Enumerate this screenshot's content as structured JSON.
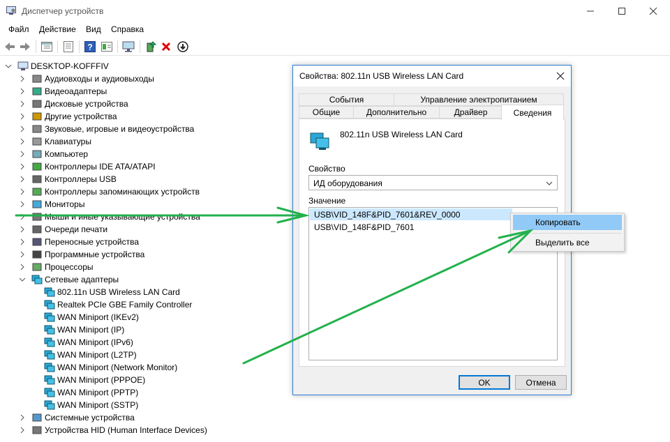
{
  "window": {
    "title": "Диспетчер устройств"
  },
  "menu": [
    "Файл",
    "Действие",
    "Вид",
    "Справка"
  ],
  "tree": {
    "root": "DESKTOP-KOFFFIV",
    "categories": [
      {
        "label": "Аудиовходы и аудиовыходы",
        "icon": "speaker-icon"
      },
      {
        "label": "Видеоадаптеры",
        "icon": "display-adapter-icon"
      },
      {
        "label": "Дисковые устройства",
        "icon": "disk-icon"
      },
      {
        "label": "Другие устройства",
        "icon": "unknown-device-icon"
      },
      {
        "label": "Звуковые, игровые и видеоустройства",
        "icon": "speaker-icon"
      },
      {
        "label": "Клавиатуры",
        "icon": "keyboard-icon"
      },
      {
        "label": "Компьютер",
        "icon": "computer-icon"
      },
      {
        "label": "Контроллеры IDE ATA/ATAPI",
        "icon": "ide-icon"
      },
      {
        "label": "Контроллеры USB",
        "icon": "usb-icon"
      },
      {
        "label": "Контроллеры запоминающих устройств",
        "icon": "storage-icon"
      },
      {
        "label": "Мониторы",
        "icon": "monitor-icon"
      },
      {
        "label": "Мыши и иные указывающие устройства",
        "icon": "mouse-icon"
      },
      {
        "label": "Очереди печати",
        "icon": "printer-icon"
      },
      {
        "label": "Переносные устройства",
        "icon": "portable-icon"
      },
      {
        "label": "Программные устройства",
        "icon": "software-device-icon"
      },
      {
        "label": "Процессоры",
        "icon": "cpu-icon"
      },
      {
        "label": "Сетевые адаптеры",
        "icon": "network-icon"
      }
    ],
    "network_children": [
      "802.11n USB Wireless LAN Card",
      "Realtek PCIe GBE Family Controller",
      "WAN Miniport (IKEv2)",
      "WAN Miniport (IP)",
      "WAN Miniport (IPv6)",
      "WAN Miniport (L2TP)",
      "WAN Miniport (Network Monitor)",
      "WAN Miniport (PPPOE)",
      "WAN Miniport (PPTP)",
      "WAN Miniport (SSTP)"
    ],
    "after": [
      {
        "label": "Системные устройства",
        "icon": "system-icon"
      },
      {
        "label": "Устройства HID (Human Interface Devices)",
        "icon": "hid-icon"
      }
    ]
  },
  "dialog": {
    "title": "Свойства: 802.11n USB Wireless LAN Card",
    "tabs_top": [
      "События",
      "Управление электропитанием"
    ],
    "tabs_bottom": [
      "Общие",
      "Дополнительно",
      "Драйвер",
      "Сведения"
    ],
    "device_name": "802.11n USB Wireless LAN Card",
    "property_label": "Свойство",
    "property_value": "ИД оборудования",
    "value_label": "Значение",
    "values": [
      "USB\\VID_148F&PID_7601&REV_0000",
      "USB\\VID_148F&PID_7601"
    ],
    "ok": "OK",
    "cancel": "Отмена"
  },
  "context_menu": {
    "copy": "Копировать",
    "select_all": "Выделить все"
  },
  "colors": {
    "accent": "#0078d7",
    "selection": "#cce8ff",
    "menu_highlight": "#91c9f7",
    "annotation_arrow": "#22b14c"
  }
}
